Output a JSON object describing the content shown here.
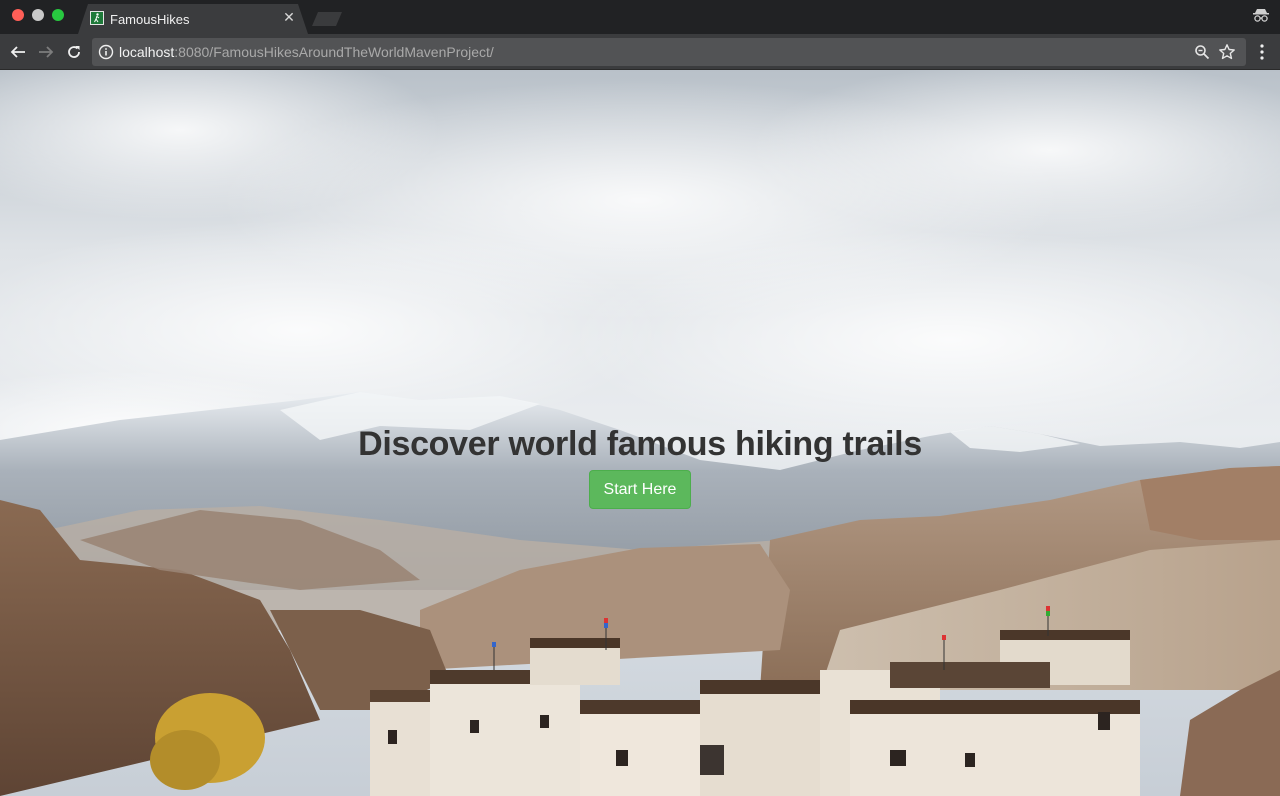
{
  "browser": {
    "tab": {
      "title": "FamousHikes",
      "favicon": "hiker-favicon-icon",
      "close": "✕"
    },
    "address_bar": {
      "host": "localhost",
      "rest": ":8080/FamousHikesAroundTheWorldMavenProject/"
    },
    "icons": [
      "back-arrow-icon",
      "forward-arrow-icon",
      "reload-icon",
      "info-icon",
      "zoom-icon",
      "star-icon",
      "menu-icon",
      "incognito-icon"
    ]
  },
  "hero": {
    "heading": "Discover world famous hiking trails",
    "button_label": "Start Here",
    "button_color": "#5cb85c",
    "heading_color": "#333333"
  }
}
